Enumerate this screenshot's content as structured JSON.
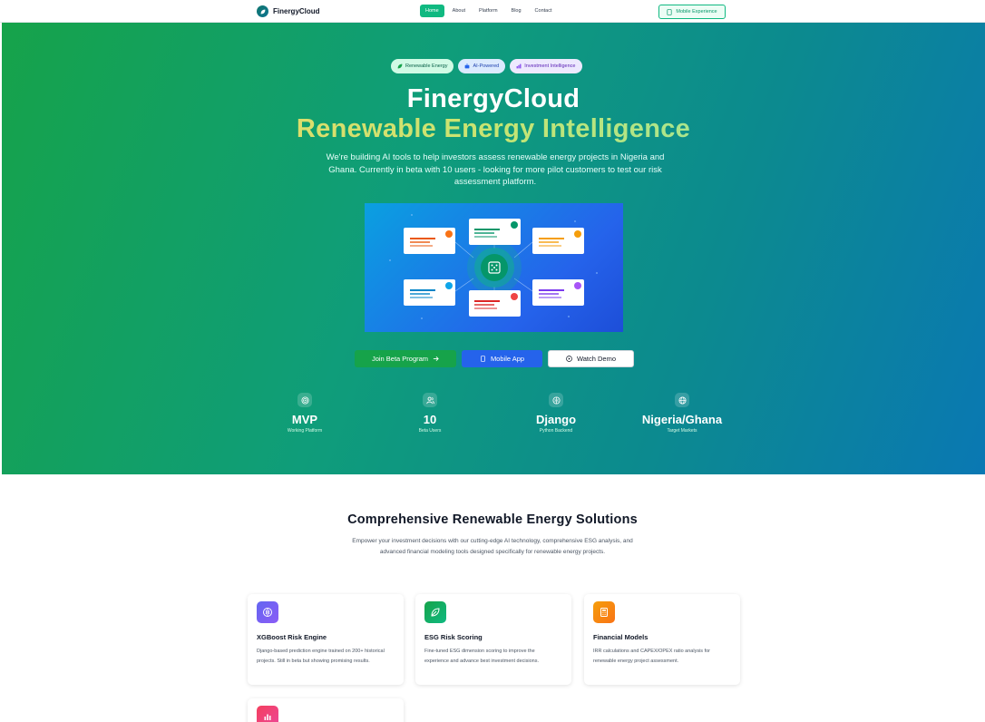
{
  "nav": {
    "brand": "FinergyCloud",
    "links": [
      "Home",
      "About",
      "Platform",
      "Blog",
      "Contact"
    ],
    "active_link": "Home",
    "mobile_button": "Mobile Experience"
  },
  "hero": {
    "badges": [
      {
        "label": "Renewable Energy",
        "icon": "leaf-icon"
      },
      {
        "label": "AI-Powered",
        "icon": "robot-icon"
      },
      {
        "label": "Investment Intelligence",
        "icon": "chart-icon"
      }
    ],
    "title": "FinergyCloud",
    "subtitle": "Renewable Energy Intelligence",
    "description": "We're building AI tools to help investors assess renewable energy projects in Nigeria and Ghana. Currently in beta with 10 users - looking for more pilot customers to test our risk assessment platform.",
    "buttons": {
      "beta": "Join Beta Program",
      "mobile": "Mobile App",
      "demo": "Watch Demo"
    },
    "stats": [
      {
        "value": "MVP",
        "label": "Working Platform",
        "icon": "target-icon"
      },
      {
        "value": "10",
        "label": "Beta Users",
        "icon": "users-icon"
      },
      {
        "value": "Django",
        "label": "Python Backend",
        "icon": "brain-icon"
      },
      {
        "value": "Nigeria/Ghana",
        "label": "Target Markets",
        "icon": "globe-icon"
      }
    ]
  },
  "solutions": {
    "title": "Comprehensive Renewable Energy Solutions",
    "description": "Empower your investment decisions with our cutting-edge AI technology, comprehensive ESG analysis, and advanced financial modeling tools designed specifically for renewable energy projects.",
    "cards": [
      {
        "title": "XGBoost Risk Engine",
        "text": "Django-based prediction engine trained on 200+ historical projects. Still in beta but showing promising results.",
        "icon": "brain-icon",
        "color": "#6366f1"
      },
      {
        "title": "ESG Risk Scoring",
        "text": "Fine-tuned ESG dimension scoring to improve the experience and advance best investment decisions.",
        "icon": "leaf-icon",
        "color": "#16a34a"
      },
      {
        "title": "Financial Models",
        "text": "IRR calculations and CAPEX/OPEX ratio analysis for renewable energy project assessment.",
        "icon": "calculator-icon",
        "color": "#f97316"
      },
      {
        "title": "",
        "text": "",
        "icon": "chart-bar-icon",
        "color": "#f43f5e"
      }
    ]
  }
}
